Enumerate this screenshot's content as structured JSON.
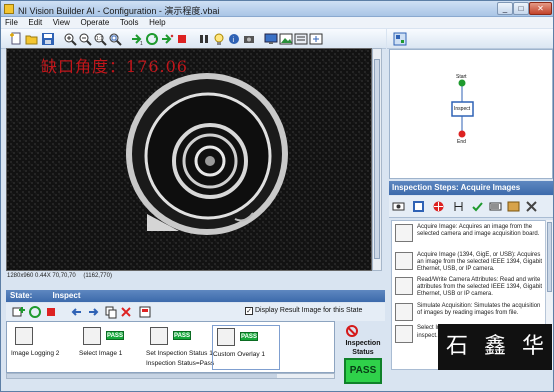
{
  "window": {
    "title": "NI Vision Builder AI - Configuration - 演示程度.vbai",
    "controls": {
      "minimize": "_",
      "maximize": "□",
      "close": "✕"
    }
  },
  "menu": [
    "File",
    "Edit",
    "View",
    "Operate",
    "Tools",
    "Help"
  ],
  "toolbar_icons": [
    "new-icon",
    "open-icon",
    "save-icon",
    "zoom-in-icon",
    "zoom-out-icon",
    "zoom-fit-icon",
    "zoom-region-icon",
    "run-once-icon",
    "run-continuous-icon",
    "step-icon",
    "stop-icon",
    "pause-icon",
    "info-icon",
    "camera-icon",
    "display-icon",
    "image-icon",
    "settings-icon",
    "expand-icon"
  ],
  "image_view": {
    "overlay_text": "缺口角度：176.06",
    "overlay_color": "#c0161b",
    "info": [
      "1280x960 0.44X 70,70,70",
      "(1162,770)"
    ]
  },
  "flowchart": {
    "start_label": "Start",
    "inspect_label": "Inspect",
    "end_label": "End"
  },
  "inspection_steps": {
    "header": "Inspection Steps: Acquire Images",
    "items": [
      {
        "icon": "acquire-image-icon",
        "text": "Acquire Image:  Acquires an image from the selected camera and image acquisition board."
      },
      {
        "icon": "acquire-1394-icon",
        "text": "Acquire Image (1394, GigE, or USB): Acquires an image from the selected IEEE 1394, Gigabit Ethernet, USB, or IP camera."
      },
      {
        "icon": "camera-attributes-icon",
        "text": "Read/Write Camera Attributes:  Read and write attributes from the selected IEEE 1394, Gigabit Ethernet, USB or IP camera."
      },
      {
        "icon": "simulate-acquisition-icon",
        "text": "Simulate Acquisition:  Simulates the acquisition of images by reading images from file."
      },
      {
        "icon": "select-image-icon",
        "text": "Select Image: Select..."
      },
      {
        "icon": "inspect-icon",
        "text": "inspect..."
      }
    ]
  },
  "watermark": [
    "石",
    "鑫",
    "华"
  ],
  "state": {
    "label": "State:",
    "value": "Inspect",
    "display_result_label": "Display Result Image for this State",
    "display_result_checked": "✓"
  },
  "state_steps": [
    {
      "label": "Image Logging 2",
      "sub": "",
      "pass": ""
    },
    {
      "label": "Select Image 1",
      "sub": "",
      "pass": "PASS"
    },
    {
      "label": "Set Inspection Status 1",
      "sub": "Inspection Status=Pass",
      "pass": "PASS"
    },
    {
      "label": "Custom Overlay 1",
      "sub": "",
      "pass": "PASS"
    }
  ],
  "inspection_status": {
    "label": "Inspection Status",
    "result": "PASS"
  }
}
